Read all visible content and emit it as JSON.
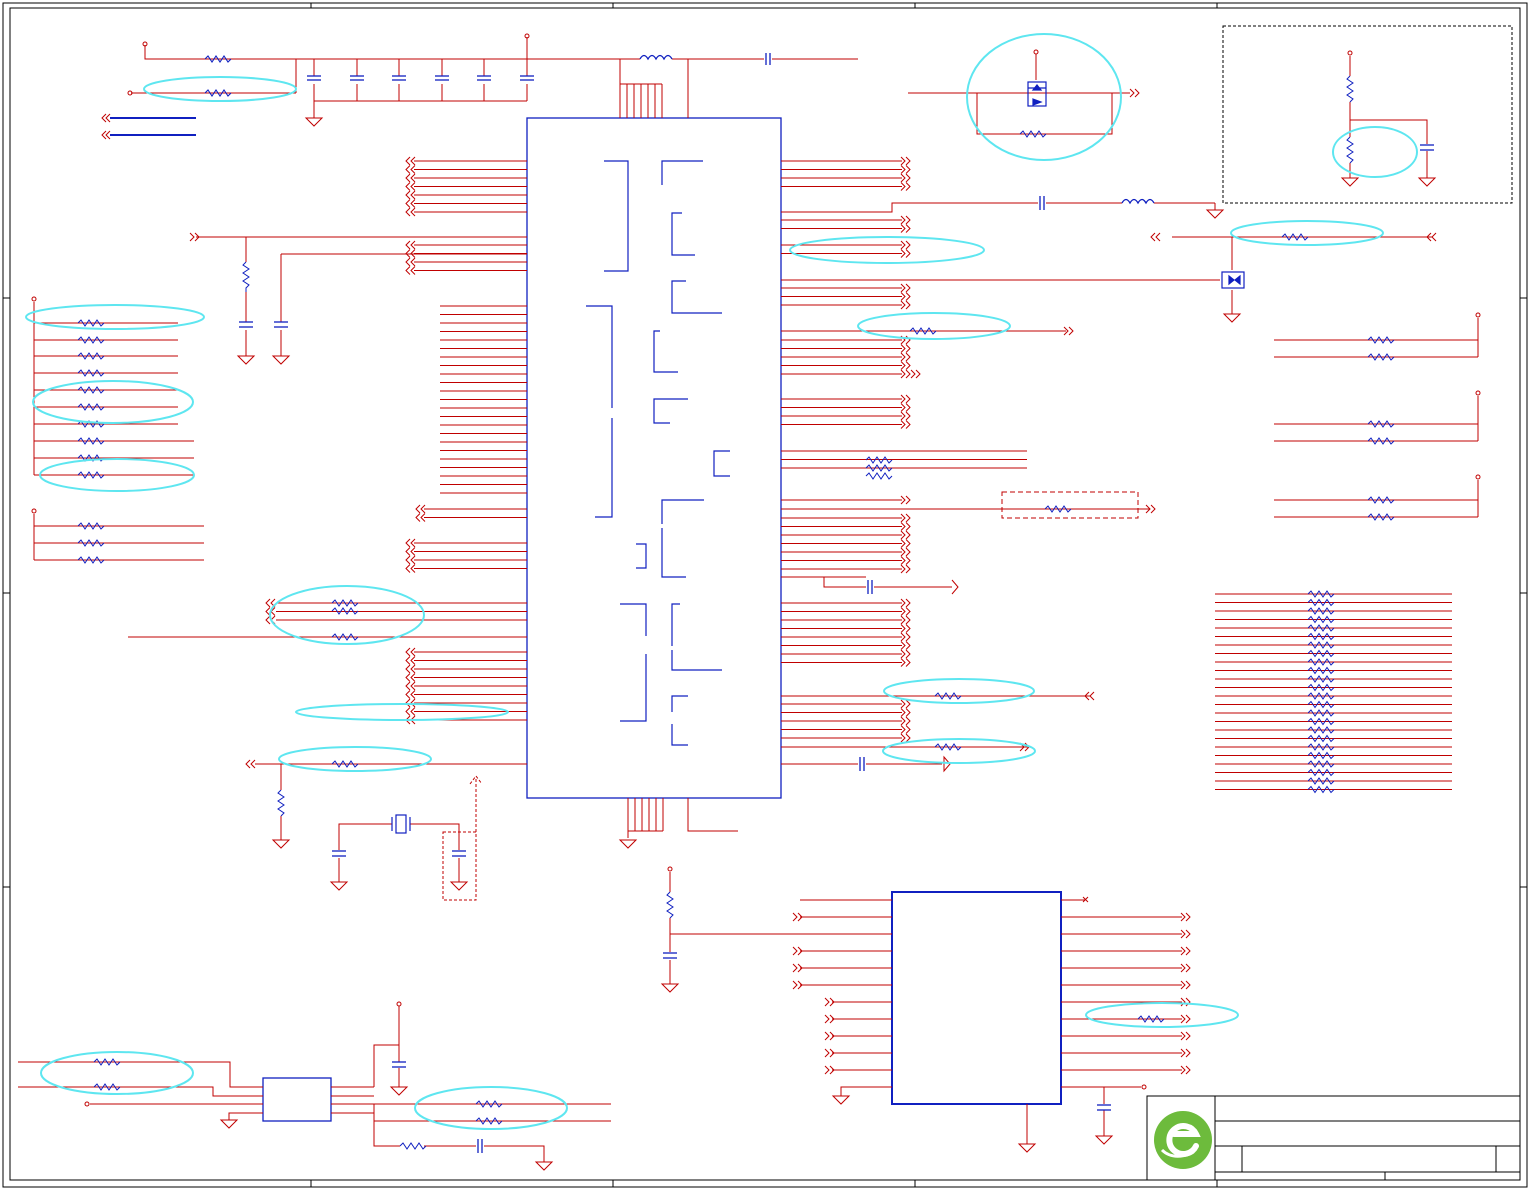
{
  "colors": {
    "wire": "#c00000",
    "component": "#1020c0",
    "net_dot": "#c000c0",
    "highlight": "#5ee6f0",
    "border": "#000000",
    "logo_green": "#6dbb3c"
  },
  "icons": {
    "logo": "company-logo-icon",
    "resistor": "resistor-icon",
    "capacitor": "capacitor-icon",
    "inductor": "inductor-icon",
    "ground": "ground-icon",
    "power": "power-pin-icon",
    "crystal": "crystal-icon",
    "mosfet": "mosfet-icon",
    "connector": "off-page-connector-icon"
  }
}
